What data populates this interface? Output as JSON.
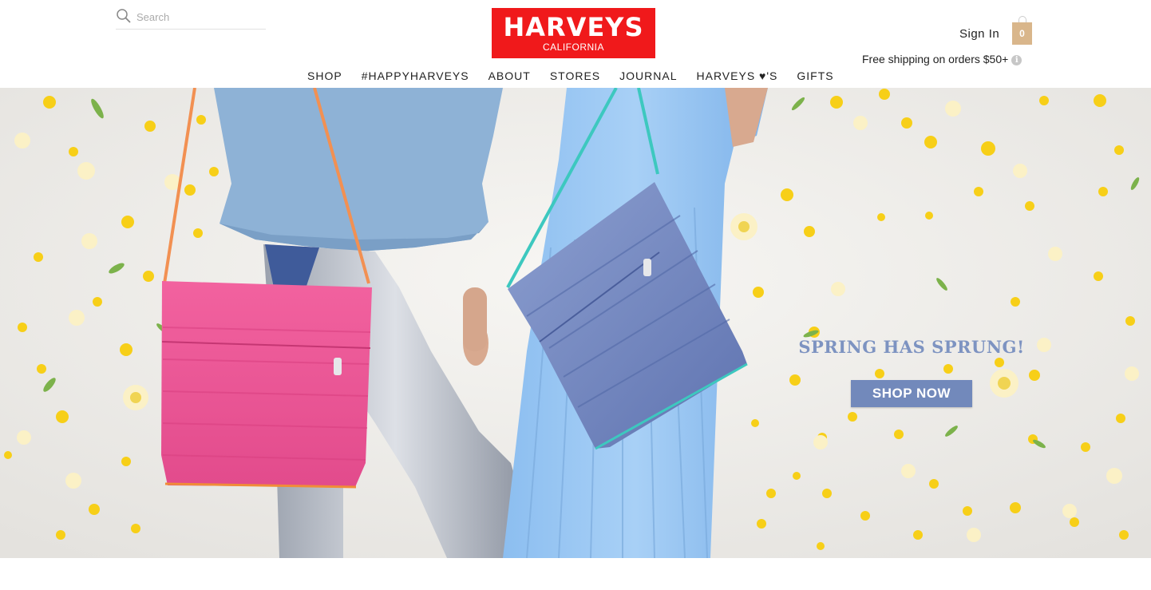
{
  "search": {
    "placeholder": "Search"
  },
  "logo": {
    "main": "HARVEYS",
    "sub": "CALIFORNIA"
  },
  "account": {
    "sign_in": "Sign In"
  },
  "cart": {
    "count": "0"
  },
  "shipping": {
    "text": "Free shipping on orders $50+"
  },
  "nav": {
    "items": [
      "SHOP",
      "#HAPPYHARVEYS",
      "ABOUT",
      "STORES",
      "JOURNAL",
      "HARVEYS ♥'S",
      "GIFTS"
    ]
  },
  "hero": {
    "headline": "SPRING HAS SPRUNG!",
    "cta": "SHOP NOW"
  },
  "colors": {
    "brand_red": "#f0191b",
    "cart_tan": "#d9b68b",
    "cta_blue": "#7289bb",
    "headline_blue": "#7d93c1"
  },
  "icons": {
    "search": "search-icon",
    "cart": "shopping-bag-icon",
    "info": "info-icon"
  }
}
